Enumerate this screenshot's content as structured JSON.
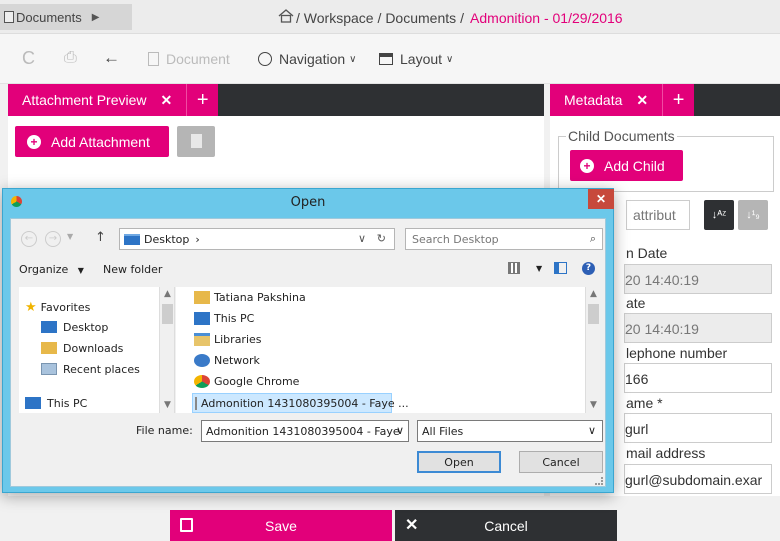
{
  "topbar": {
    "documents_label": "Documents",
    "breadcrumb": [
      "/ Workspace",
      "/ Documents",
      "/"
    ],
    "breadcrumb_active": "Admonition - 01/29/2016"
  },
  "toolbar": {
    "refresh": "C",
    "print": "⎙",
    "back": "←",
    "document_label": "Document",
    "navigation_label": "Navigation",
    "layout_label": "Layout"
  },
  "left_panel": {
    "tab_label": "Attachment Preview",
    "close": "✕",
    "plus": "+",
    "add_attachment": "Add Attachment"
  },
  "right_panel": {
    "tab_label": "Metadata",
    "close": "✕",
    "plus": "+",
    "child_documents_legend": "Child Documents",
    "add_child": "Add Child",
    "attribute_filter_placeholder": "attribut",
    "fields": [
      {
        "label": "n Date",
        "value": "20 14:40:19"
      },
      {
        "label": "ate",
        "value": "20 14:40:19"
      },
      {
        "label": "lephone number",
        "value": "166"
      },
      {
        "label": "ame *",
        "value": "gurl"
      },
      {
        "label": "mail address",
        "value": "gurl@subdomain.exar"
      }
    ]
  },
  "footer": {
    "save": "Save",
    "cancel": "Cancel"
  },
  "dialog": {
    "title": "Open",
    "close": "✕",
    "address": "Desktop",
    "address_arrow": "›",
    "search_placeholder": "Search Desktop",
    "organize": "Organize",
    "new_folder": "New folder",
    "nav_items": [
      {
        "label": "Favorites",
        "icon": "star-icon"
      },
      {
        "label": "Desktop",
        "icon": "desktop-icon"
      },
      {
        "label": "Downloads",
        "icon": "downloads-icon"
      },
      {
        "label": "Recent places",
        "icon": "recent-places-icon"
      },
      {
        "label": "This PC",
        "icon": "computer-icon"
      }
    ],
    "files": [
      {
        "label": "Tatiana Pakshina",
        "icon": "user-folder-icon"
      },
      {
        "label": "This PC",
        "icon": "computer-icon"
      },
      {
        "label": "Libraries",
        "icon": "libraries-icon"
      },
      {
        "label": "Network",
        "icon": "network-icon"
      },
      {
        "label": "Google Chrome",
        "icon": "chrome-icon"
      },
      {
        "label": "Admonition 1431080395004 - Faye ...",
        "icon": "file-icon",
        "selected": true
      }
    ],
    "file_name_label": "File name:",
    "file_name_value": "Admonition 1431080395004 - Faye",
    "file_type": "All Files",
    "open_button": "Open",
    "cancel_button": "Cancel"
  },
  "colors": {
    "accent": "#e2007a",
    "dark": "#2e3033",
    "dialog_frame": "#6bc8ea",
    "dialog_close": "#c7493c"
  }
}
